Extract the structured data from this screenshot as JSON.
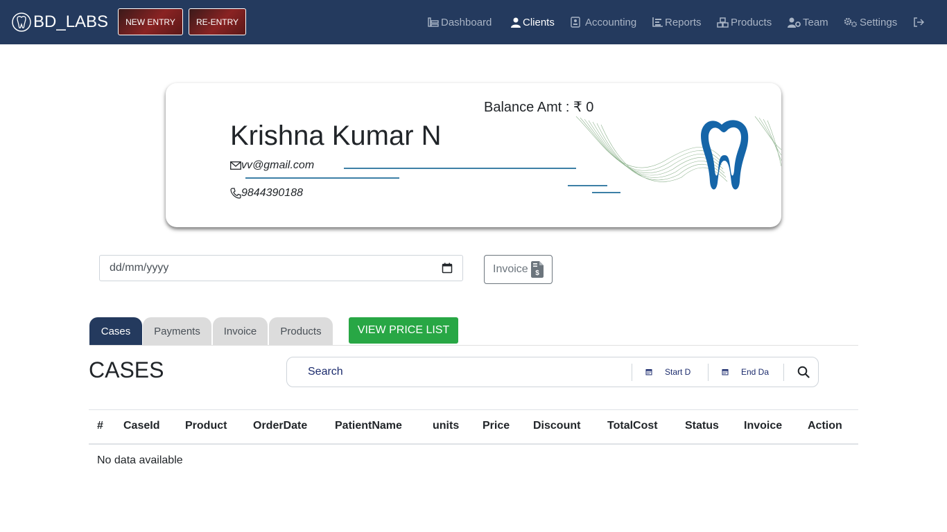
{
  "navbar": {
    "brand": "BD_LABS",
    "new_entry": "NEW ENTRY",
    "re_entry": "RE-ENTRY",
    "links": {
      "dashboard": "Dashboard",
      "clients": "Clients",
      "accounting": "Accounting",
      "reports": "Reports",
      "products": "Products",
      "team": "Team",
      "settings": "Settings"
    }
  },
  "client": {
    "balance": "Balance Amt : ₹ 0",
    "name": "Krishna Kumar N",
    "email": "vv@gmail.com",
    "phone": "9844390188"
  },
  "filters": {
    "date_placeholder": "dd/mm/yyyy",
    "invoice_label": "Invoice"
  },
  "tabs": {
    "cases": "Cases",
    "payments": "Payments",
    "invoice": "Invoice",
    "products": "Products",
    "view_price_list": "VIEW PRICE LIST"
  },
  "cases": {
    "title": "CASES",
    "search_placeholder": "Search",
    "start_date": "Start D",
    "end_date": "End Da",
    "columns": [
      "#",
      "CaseId",
      "Product",
      "OrderDate",
      "PatientName",
      "units",
      "Price",
      "Discount",
      "TotalCost",
      "Status",
      "Invoice",
      "Action"
    ],
    "empty_message": "No data available"
  },
  "colors": {
    "navbar": "#243a5e",
    "accent_green": "#28a745",
    "tooth_blue": "#1565a8"
  }
}
